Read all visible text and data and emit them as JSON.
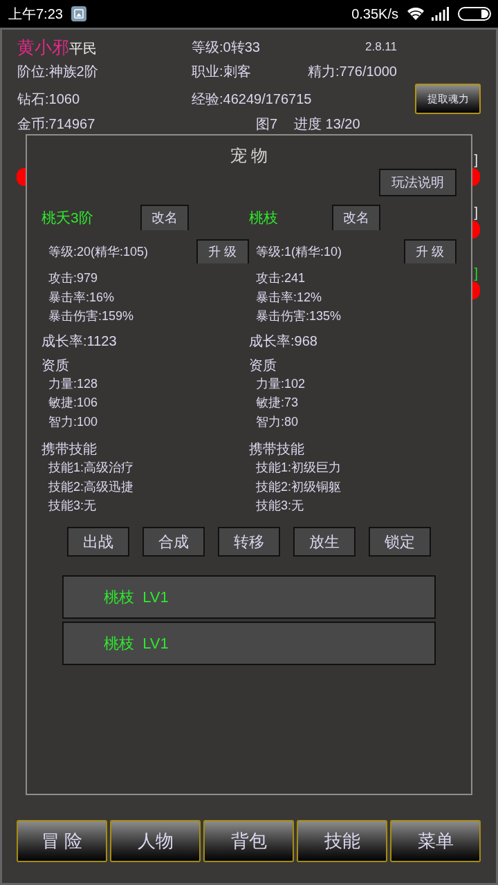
{
  "status_bar": {
    "time": "上午7:23",
    "net_speed": "0.35K/s"
  },
  "player": {
    "name": "黄小邪",
    "title": "平民",
    "level": "等级:0转33",
    "version": "2.8.11",
    "rank": "阶位:神族2阶",
    "job": "职业:刺客",
    "energy": "精力:776/1000",
    "diamonds": "钻石:1060",
    "exp": "经验:46249/176715",
    "extract_button": "提取魂力",
    "coins": "金币:714967",
    "map": "图7",
    "progress": "进度 13/20"
  },
  "background_rows": [
    {
      "bracket": "]",
      "color": "#e6e6e6",
      "left_dot": true
    },
    {
      "bracket": "]",
      "color": "#e6e6e6",
      "left_dot": false
    },
    {
      "bracket": "]",
      "color": "#22dd22",
      "left_dot": false
    }
  ],
  "dialog": {
    "title": "宠 物",
    "help_button": "玩法说明",
    "pets": [
      {
        "name": "桃夭3阶",
        "rename_button": "改名",
        "level": "等级:20(精华:105)",
        "upgrade_button": "升 级",
        "stats": [
          "攻击:979",
          "暴击率:16%",
          "暴击伤害:159%"
        ],
        "growth": "成长率:1123",
        "aptitude_heading": "资质",
        "aptitudes": [
          "力量:128",
          "敏捷:106",
          "智力:100"
        ],
        "skills_heading": "携带技能",
        "skills": [
          "技能1:高级治疗",
          "技能2:高级迅捷",
          "技能3:无"
        ]
      },
      {
        "name": "桃枝",
        "rename_button": "改名",
        "level": "等级:1(精华:10)",
        "upgrade_button": "升 级",
        "stats": [
          "攻击:241",
          "暴击率:12%",
          "暴击伤害:135%"
        ],
        "growth": "成长率:968",
        "aptitude_heading": "资质",
        "aptitudes": [
          "力量:102",
          "敏捷:73",
          "智力:80"
        ],
        "skills_heading": "携带技能",
        "skills": [
          "技能1:初级巨力",
          "技能2:初级铜躯",
          "技能3:无"
        ]
      }
    ],
    "actions": [
      "出战",
      "合成",
      "转移",
      "放生",
      "锁定"
    ],
    "pet_list": [
      {
        "label": "桃枝  LV1"
      },
      {
        "label": "桃枝  LV1"
      }
    ]
  },
  "bottom_nav": [
    "冒 险",
    "人物",
    "背包",
    "技能",
    "菜单"
  ]
}
